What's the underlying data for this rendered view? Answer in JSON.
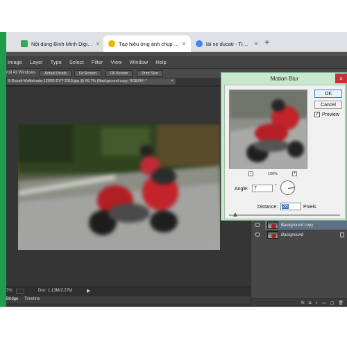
{
  "browser": {
    "tabs": [
      {
        "title": "Nội dung Bình Minh Digit…",
        "close": "×",
        "icon_color": "#34a853"
      },
      {
        "title": "Tạo hiệu ứng ảnh chụp Pa…",
        "close": "×",
        "icon_color": "#f4b400"
      },
      {
        "title": "lái xe ducati - Tìm với Goo…",
        "close": "×",
        "icon_color": "#4285f4"
      }
    ],
    "new_tab": "+"
  },
  "photoshop": {
    "menu": [
      "Image",
      "Layer",
      "Type",
      "Select",
      "Filter",
      "View",
      "Window",
      "Help"
    ],
    "options": {
      "scroll_all": "roll All Windows",
      "buttons": [
        "Actual Pixels",
        "Fit Screen",
        "Fill Screen",
        "Print Size"
      ]
    },
    "document_tab": "S-Ducati-Multistrada-1200S-DVT-2015.jpg @ 66.7% (Background copy, RGB/8#) *",
    "document_close": "×",
    "status": {
      "zoom": "7%",
      "doc": "Doc: 1.13M/2.27M",
      "arrow": "▶"
    },
    "bottom_tabs": [
      "Bridge",
      "Timeline"
    ],
    "layers": [
      {
        "name": "Background copy",
        "selected": true
      },
      {
        "name": "Background",
        "selected": false
      }
    ],
    "layer_footer_icons": [
      "fx",
      "◘",
      "◐",
      "▭",
      "▢",
      "🗑"
    ]
  },
  "motion_blur": {
    "title": "Motion Blur",
    "close": "×",
    "ok": "OK",
    "cancel": "Cancel",
    "preview_label": "Preview",
    "preview_checked": "✓",
    "zoom_minus": "−",
    "zoom_value": "100%",
    "zoom_plus": "+",
    "angle_label": "Angle:",
    "angle_value": "7",
    "degree_symbol": "°",
    "distance_label": "Distance:",
    "distance_value": "28",
    "distance_unit": "Pixels"
  }
}
